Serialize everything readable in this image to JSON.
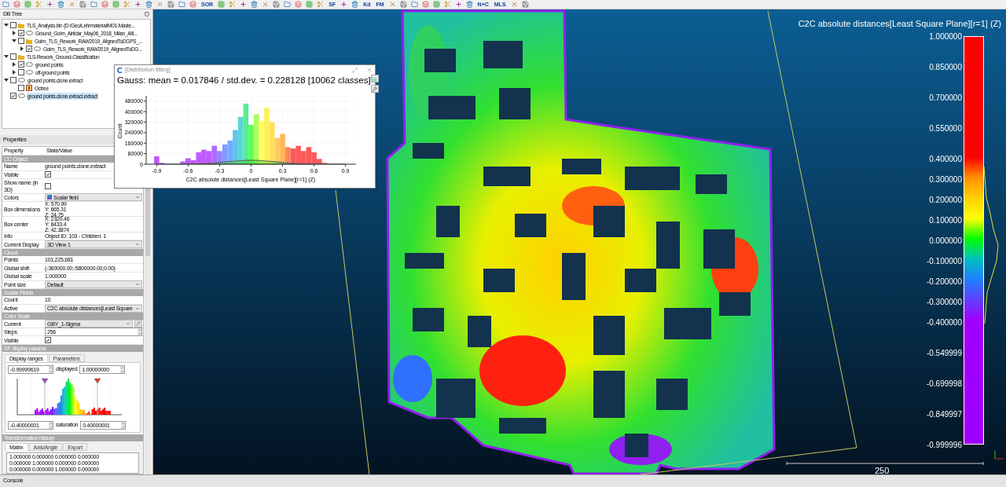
{
  "toolbar": {
    "labels": [
      "SOR",
      "SF",
      "Kd",
      "FM",
      "N+C",
      "MLS"
    ]
  },
  "db_tree": {
    "title": "DB Tree",
    "items": [
      {
        "label": "TLS_Analysis.bin (D:/Geo/Lehrmaterial/M01-Maste...",
        "kind": "folder",
        "checked": false,
        "expanded": true,
        "selected": false,
        "children": [
          {
            "label": "Ground_Golm_Airlidar_May06_2018_Milan_Alli...",
            "kind": "cloud",
            "checked": true,
            "expanded": false,
            "selected": false
          },
          {
            "label": "Golm_TLS_Rework_RAW2019_AlignedToDGPS_...",
            "kind": "folder",
            "checked": false,
            "expanded": true,
            "selected": false,
            "children": [
              {
                "label": "Golm_TLS_Rework_RAW2019_AlignedToDG...",
                "kind": "cloud",
                "checked": true,
                "expanded": false,
                "selected": false
              }
            ]
          }
        ]
      },
      {
        "label": "TLS-Rework_Ground-Classification",
        "kind": "folder",
        "checked": false,
        "expanded": true,
        "selected": false,
        "children": [
          {
            "label": "ground points",
            "kind": "cloud",
            "checked": true,
            "expanded": false,
            "selected": false
          },
          {
            "label": "off-ground points",
            "kind": "cloud",
            "checked": false,
            "expanded": false,
            "selected": false
          }
        ]
      },
      {
        "label": "ground points.clone.extract",
        "kind": "cloud",
        "checked": false,
        "expanded": true,
        "selected": false,
        "children": [
          {
            "label": "Octree",
            "kind": "octree",
            "checked": false,
            "selected": false
          }
        ]
      },
      {
        "label": "ground points.clone.extract.extract",
        "kind": "cloud",
        "checked": true,
        "selected": true
      }
    ]
  },
  "properties": {
    "title": "Properties",
    "columns": [
      "Property",
      "State/Value"
    ],
    "rows": [
      {
        "kind": "section",
        "label": "CC Object"
      },
      {
        "kind": "text",
        "label": "Name",
        "value": "ground points.clone.extract"
      },
      {
        "kind": "checkbox",
        "label": "Visible",
        "checked": true
      },
      {
        "kind": "checkbox",
        "label": "Show name (in 3D)",
        "checked": false
      },
      {
        "kind": "combo",
        "label": "Colors",
        "value": "Scalar field"
      },
      {
        "kind": "lines",
        "label": "Box dimensions",
        "lines": [
          "X: 570.99",
          "Y: 665.31",
          "Z: 24.75"
        ]
      },
      {
        "kind": "lines",
        "label": "Box center",
        "lines": [
          "X: 2320.46",
          "Y: 8433.4",
          "Z: 42.3874"
        ]
      },
      {
        "kind": "text",
        "label": "Info",
        "value": "Object ID: 103 - Children: 1"
      },
      {
        "kind": "combo",
        "label": "Current Display",
        "value": "3D View 1"
      },
      {
        "kind": "section",
        "label": "Cloud"
      },
      {
        "kind": "text",
        "label": "Points",
        "value": "101,225,681"
      },
      {
        "kind": "text",
        "label": "Global shift",
        "value": "(-360000.00;-5800000.00;0.00)"
      },
      {
        "kind": "text",
        "label": "Global scale",
        "value": "1.000000"
      },
      {
        "kind": "combo",
        "label": "Point size",
        "value": "Default"
      },
      {
        "kind": "section",
        "label": "Scalar Fields"
      },
      {
        "kind": "text",
        "label": "Count",
        "value": "10"
      },
      {
        "kind": "combo",
        "label": "Active",
        "value": "C2C absolute distances[Least Square"
      },
      {
        "kind": "section",
        "label": "Color Scale"
      },
      {
        "kind": "combo_button",
        "label": "Current",
        "value": "GBY_1-Sigma"
      },
      {
        "kind": "spin",
        "label": "Steps",
        "value": "256"
      },
      {
        "kind": "checkbox",
        "label": "Visible",
        "checked": true
      },
      {
        "kind": "section",
        "label": "SF display params"
      }
    ],
    "sf_display": {
      "tabs": [
        {
          "label": "Display ranges",
          "selected": true
        },
        {
          "label": "Parameters",
          "selected": false
        }
      ],
      "displayed_min": "-0.99999619",
      "displayed_label": "displayed",
      "displayed_max": "1.00000000",
      "saturation_min": "-0.40000001",
      "saturation_label": "saturation",
      "saturation_max": "0.40000001"
    },
    "transformation": {
      "title": "Transformation history",
      "tabs": [
        {
          "label": "Matrix",
          "selected": true
        },
        {
          "label": "Axis/Angle",
          "selected": false
        },
        {
          "label": "Export",
          "selected": false
        }
      ],
      "matrix": [
        "1.000000 0.000000 0.000000 0.000000",
        "0.000000 1.000000 0.000000 0.000000",
        "0.000000 0.000000 1.000000 0.000000"
      ]
    }
  },
  "console": {
    "title": "Console"
  },
  "view": {
    "scale_title": "C2C absolute distances[Least Square Plane][r=1] (Z)",
    "scale_labels": [
      "1.000000",
      "0.850000",
      "0.700000",
      "0.550000",
      "0.400000",
      "0.300000",
      "0.200000",
      "0.100000",
      "0.000000",
      "-0.100000",
      "-0.200000",
      "-0.300000",
      "-0.400000",
      "-0.549999",
      "-0.699998",
      "-0.849997",
      "-0.999996"
    ],
    "scale_bar": "250"
  },
  "dialog": {
    "title": "[Distribution fitting]",
    "heading": "Gauss: mean = 0.017846 / std.dev. = 0.228128 [10062 classes]",
    "chart_data": {
      "type": "bar",
      "xlabel": "C2C absolute distances[Least Square Plane][r=1] (Z)",
      "ylabel": "Count",
      "x": [
        -0.9,
        -0.85,
        -0.8,
        -0.75,
        -0.7,
        -0.65,
        -0.6,
        -0.55,
        -0.5,
        -0.45,
        -0.4,
        -0.35,
        -0.3,
        -0.25,
        -0.2,
        -0.15,
        -0.1,
        -0.05,
        0,
        0.05,
        0.1,
        0.15,
        0.2,
        0.25,
        0.3,
        0.35,
        0.4,
        0.45,
        0.5,
        0.55,
        0.6,
        0.65,
        0.7,
        0.75,
        0.8,
        0.85,
        0.9
      ],
      "series": [
        {
          "type": "bar",
          "colors": [
            "#c159ff",
            "#c159ff",
            "#c159ff",
            "#c159ff",
            "#c159ff",
            "#c159ff",
            "#c159ff",
            "#c159ff",
            "#c159ff",
            "#c159ff",
            "#c159ff",
            "#ac6eff",
            "#9883ff",
            "#8398ff",
            "#6eacff",
            "#64c1eb",
            "#59d6d6",
            "#59eb98",
            "#59ff59",
            "#acff59",
            "#ffff59",
            "#fff059",
            "#ffe059",
            "#ffcb59",
            "#ffb759",
            "#ff8859",
            "#ff5959",
            "#ff5959",
            "#ff5959",
            "#ff5959",
            "#ff5959",
            "#ff5959",
            "#ff5959",
            "#ff5959",
            "#ff5959",
            "#ff5959",
            "#ff5959"
          ],
          "values": [
            60000,
            10000,
            0,
            0,
            null,
            20000,
            45000,
            30000,
            90000,
            110000,
            100000,
            140000,
            100000,
            150000,
            180000,
            260000,
            360000,
            460000,
            300000,
            380000,
            330000,
            430000,
            320000,
            200000,
            230000,
            130000,
            120000,
            140000,
            100000,
            130000,
            90000,
            40000,
            10000,
            0,
            0,
            0,
            0
          ]
        },
        {
          "type": "area",
          "values": [
            0,
            0,
            0,
            0,
            0,
            1000,
            1000,
            2000,
            3000,
            4000,
            7000,
            9000,
            13000,
            17000,
            21000,
            24000,
            27000,
            29000,
            30000,
            29000,
            27000,
            24000,
            21000,
            17000,
            13000,
            9000,
            7000,
            4000,
            3000,
            2000,
            1000,
            1000,
            0,
            0,
            0,
            0,
            0
          ]
        }
      ],
      "grid": true,
      "xlim": [
        -1,
        1
      ],
      "ylim": [
        0,
        520000
      ],
      "xticks": [
        -0.9,
        -0.6,
        -0.3,
        0,
        0.3,
        0.6,
        0.9
      ],
      "yticks": [
        0,
        80000,
        160000,
        240000,
        320000,
        400000,
        480000
      ]
    }
  }
}
